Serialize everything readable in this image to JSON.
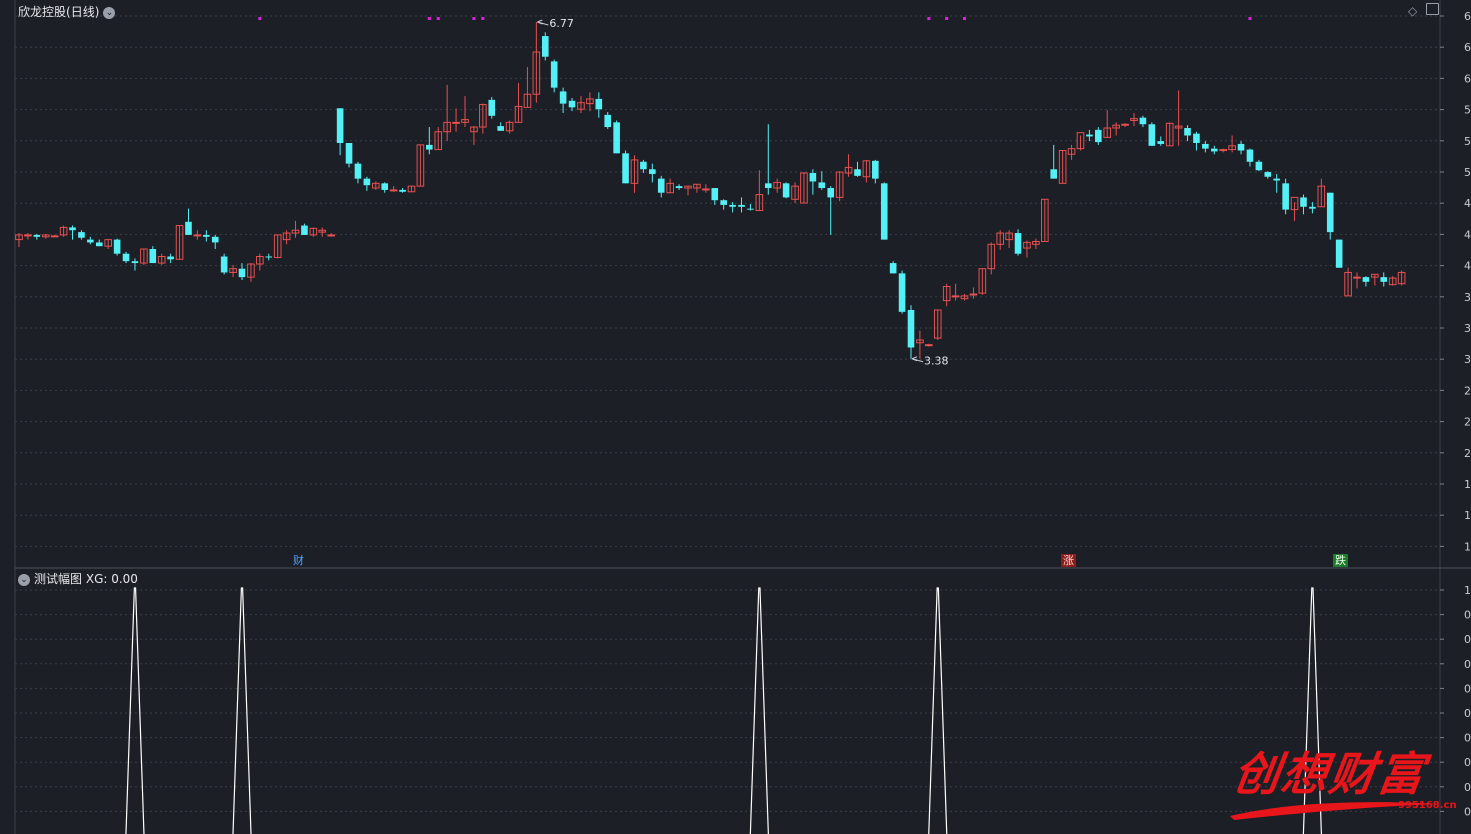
{
  "header": {
    "stock_name": "欣龙控股",
    "period_label": "(日线)",
    "indicator_name": "测试幅图",
    "indicator_value": "XG: 0.00"
  },
  "markers": {
    "cai": "财",
    "zhang": "涨",
    "die": "跌"
  },
  "watermark": {
    "text": "创想财富",
    "url": "995168.cn"
  },
  "colors": {
    "up": "#e6504f",
    "down": "#54f0f5",
    "dot": "#e020e0",
    "grid": "#3a3f4a",
    "background": "#1c1f26",
    "signal": "#ffffff",
    "watermark": "#e8151a"
  },
  "chart_data": [
    {
      "type": "candlestick",
      "title": "欣龙控股(日线)",
      "ylim": [
        3.3,
        6.9
      ],
      "high_label": "6.77",
      "low_label": "3.38",
      "candles": [
        [
          4.45,
          4.52,
          4.37,
          4.5
        ],
        [
          4.5,
          4.52,
          4.45,
          4.5
        ],
        [
          4.5,
          4.51,
          4.45,
          4.48
        ],
        [
          4.48,
          4.51,
          4.46,
          4.5
        ],
        [
          4.48,
          4.5,
          4.48,
          4.49
        ],
        [
          4.5,
          4.6,
          4.48,
          4.58
        ],
        [
          4.58,
          4.6,
          4.45,
          4.55
        ],
        [
          4.53,
          4.55,
          4.45,
          4.47
        ],
        [
          4.45,
          4.48,
          4.4,
          4.42
        ],
        [
          4.42,
          4.45,
          4.38,
          4.38
        ],
        [
          4.38,
          4.45,
          4.35,
          4.45
        ],
        [
          4.45,
          4.46,
          4.28,
          4.3
        ],
        [
          4.3,
          4.32,
          4.2,
          4.22
        ],
        [
          4.22,
          4.25,
          4.12,
          4.2
        ],
        [
          4.2,
          4.35,
          4.18,
          4.35
        ],
        [
          4.35,
          4.38,
          4.2,
          4.2
        ],
        [
          4.2,
          4.3,
          4.18,
          4.27
        ],
        [
          4.27,
          4.3,
          4.2,
          4.24
        ],
        [
          4.24,
          4.6,
          4.24,
          4.6
        ],
        [
          4.64,
          4.78,
          4.5,
          4.5
        ],
        [
          4.5,
          4.55,
          4.45,
          4.5
        ],
        [
          4.5,
          4.55,
          4.43,
          4.48
        ],
        [
          4.48,
          4.5,
          4.35,
          4.42
        ],
        [
          4.27,
          4.3,
          4.08,
          4.1
        ],
        [
          4.1,
          4.18,
          4.05,
          4.14
        ],
        [
          4.14,
          4.2,
          4.02,
          4.05
        ],
        [
          4.05,
          4.2,
          4.0,
          4.19
        ],
        [
          4.19,
          4.3,
          4.12,
          4.27
        ],
        [
          4.27,
          4.3,
          4.23,
          4.26
        ],
        [
          4.26,
          4.5,
          4.25,
          4.5
        ],
        [
          4.45,
          4.55,
          4.4,
          4.52
        ],
        [
          4.52,
          4.65,
          4.47,
          4.55
        ],
        [
          4.6,
          4.62,
          4.5,
          4.5
        ],
        [
          4.5,
          4.58,
          4.48,
          4.57
        ],
        [
          4.53,
          4.58,
          4.48,
          4.55
        ],
        [
          4.5,
          4.52,
          4.48,
          4.5
        ],
        [
          5.85,
          5.85,
          5.35,
          5.48
        ],
        [
          5.48,
          5.48,
          5.22,
          5.26
        ],
        [
          5.26,
          5.28,
          5.05,
          5.1
        ],
        [
          5.1,
          5.12,
          4.97,
          5.03
        ],
        [
          5.0,
          5.07,
          4.98,
          5.05
        ],
        [
          5.05,
          5.06,
          4.95,
          4.98
        ],
        [
          4.98,
          5.02,
          4.96,
          4.98
        ],
        [
          4.98,
          5.0,
          4.95,
          4.96
        ],
        [
          4.96,
          5.02,
          4.96,
          5.02
        ],
        [
          5.02,
          5.46,
          5.02,
          5.46
        ],
        [
          5.46,
          5.65,
          5.36,
          5.41
        ],
        [
          5.41,
          5.65,
          5.41,
          5.6
        ],
        [
          5.6,
          6.1,
          5.5,
          5.7
        ],
        [
          5.7,
          5.85,
          5.6,
          5.7
        ],
        [
          5.7,
          5.98,
          5.65,
          5.73
        ],
        [
          5.6,
          5.66,
          5.46,
          5.65
        ],
        [
          5.65,
          5.9,
          5.58,
          5.89
        ],
        [
          5.94,
          5.97,
          5.74,
          5.77
        ],
        [
          5.66,
          5.7,
          5.61,
          5.61
        ],
        [
          5.61,
          5.72,
          5.58,
          5.7
        ],
        [
          5.7,
          6.12,
          5.7,
          5.87
        ],
        [
          5.86,
          6.29,
          5.86,
          6.0
        ],
        [
          6.0,
          6.77,
          5.91,
          6.45
        ],
        [
          6.62,
          6.66,
          6.36,
          6.4
        ],
        [
          6.35,
          6.37,
          6.02,
          6.07
        ],
        [
          6.03,
          6.07,
          5.8,
          5.9
        ],
        [
          5.93,
          5.96,
          5.82,
          5.86
        ],
        [
          5.84,
          5.98,
          5.8,
          5.91
        ],
        [
          5.9,
          6.02,
          5.82,
          5.95
        ],
        [
          5.95,
          6.02,
          5.75,
          5.84
        ],
        [
          5.78,
          5.81,
          5.63,
          5.65
        ],
        [
          5.7,
          5.72,
          5.37,
          5.37
        ],
        [
          5.37,
          5.4,
          5.05,
          5.05
        ],
        [
          5.05,
          5.35,
          4.95,
          5.3
        ],
        [
          5.28,
          5.3,
          5.16,
          5.2
        ],
        [
          5.2,
          5.26,
          5.06,
          5.15
        ],
        [
          5.1,
          5.13,
          4.9,
          4.95
        ],
        [
          4.95,
          5.1,
          4.95,
          5.05
        ],
        [
          5.02,
          5.04,
          4.98,
          5.0
        ],
        [
          5.0,
          5.02,
          4.92,
          5.02
        ],
        [
          5.0,
          5.04,
          4.95,
          5.04
        ],
        [
          4.99,
          5.04,
          4.95,
          4.99
        ],
        [
          5.0,
          5.0,
          4.82,
          4.87
        ],
        [
          4.87,
          4.88,
          4.77,
          4.82
        ],
        [
          4.82,
          4.85,
          4.74,
          4.8
        ],
        [
          4.82,
          4.9,
          4.74,
          4.8
        ],
        [
          4.78,
          4.83,
          4.76,
          4.77
        ],
        [
          4.76,
          5.19,
          4.76,
          4.93
        ],
        [
          5.05,
          5.68,
          4.93,
          5.0
        ],
        [
          5.0,
          5.1,
          4.95,
          5.06
        ],
        [
          5.05,
          5.06,
          4.89,
          4.9
        ],
        [
          4.88,
          5.06,
          4.84,
          5.02
        ],
        [
          4.84,
          5.17,
          4.84,
          5.16
        ],
        [
          5.16,
          5.2,
          4.93,
          5.07
        ],
        [
          5.06,
          5.18,
          4.98,
          5.0
        ],
        [
          5.0,
          5.02,
          4.5,
          4.9
        ],
        [
          4.9,
          5.18,
          4.86,
          5.17
        ],
        [
          5.16,
          5.36,
          5.12,
          5.22
        ],
        [
          5.2,
          5.28,
          5.12,
          5.13
        ],
        [
          5.12,
          5.3,
          5.06,
          5.29
        ],
        [
          5.29,
          5.3,
          5.05,
          5.1
        ],
        [
          5.05,
          5.06,
          4.45,
          4.45
        ],
        [
          4.2,
          4.22,
          4.09,
          4.09
        ],
        [
          4.09,
          4.12,
          3.66,
          3.68
        ],
        [
          3.7,
          3.75,
          3.18,
          3.3
        ],
        [
          3.35,
          3.48,
          3.18,
          3.38
        ],
        [
          3.32,
          3.34,
          3.31,
          3.33
        ],
        [
          3.4,
          3.7,
          3.38,
          3.7
        ],
        [
          3.8,
          3.98,
          3.74,
          3.95
        ],
        [
          3.85,
          3.98,
          3.8,
          3.85
        ],
        [
          3.82,
          3.87,
          3.8,
          3.85
        ],
        [
          3.86,
          3.94,
          3.82,
          3.87
        ],
        [
          3.88,
          4.14,
          3.86,
          4.14
        ],
        [
          4.14,
          4.42,
          4.08,
          4.4
        ],
        [
          4.4,
          4.55,
          4.34,
          4.52
        ],
        [
          4.45,
          4.55,
          4.36,
          4.52
        ],
        [
          4.52,
          4.56,
          4.28,
          4.3
        ],
        [
          4.36,
          4.44,
          4.26,
          4.42
        ],
        [
          4.4,
          4.46,
          4.35,
          4.43
        ],
        [
          4.43,
          4.88,
          4.43,
          4.88
        ],
        [
          5.2,
          5.46,
          5.1,
          5.1
        ],
        [
          5.05,
          5.4,
          5.05,
          5.4
        ],
        [
          5.36,
          5.46,
          5.3,
          5.42
        ],
        [
          5.42,
          5.56,
          5.4,
          5.59
        ],
        [
          5.57,
          5.62,
          5.5,
          5.55
        ],
        [
          5.62,
          5.65,
          5.46,
          5.49
        ],
        [
          5.54,
          5.83,
          5.54,
          5.64
        ],
        [
          5.64,
          5.7,
          5.56,
          5.67
        ],
        [
          5.67,
          5.69,
          5.65,
          5.68
        ],
        [
          5.72,
          5.8,
          5.66,
          5.74
        ],
        [
          5.75,
          5.77,
          5.65,
          5.68
        ],
        [
          5.68,
          5.7,
          5.45,
          5.45
        ],
        [
          5.5,
          5.55,
          5.45,
          5.47
        ],
        [
          5.45,
          5.7,
          5.45,
          5.69
        ],
        [
          5.64,
          6.04,
          5.45,
          5.66
        ],
        [
          5.64,
          5.67,
          5.5,
          5.56
        ],
        [
          5.58,
          5.6,
          5.4,
          5.48
        ],
        [
          5.47,
          5.5,
          5.38,
          5.42
        ],
        [
          5.42,
          5.45,
          5.36,
          5.39
        ],
        [
          5.41,
          5.42,
          5.38,
          5.41
        ],
        [
          5.41,
          5.56,
          5.38,
          5.45
        ],
        [
          5.47,
          5.5,
          5.36,
          5.4
        ],
        [
          5.41,
          5.42,
          5.23,
          5.28
        ],
        [
          5.28,
          5.3,
          5.18,
          5.19
        ],
        [
          5.17,
          5.18,
          5.1,
          5.12
        ],
        [
          5.1,
          5.15,
          4.95,
          5.08
        ],
        [
          5.05,
          5.1,
          4.72,
          4.77
        ],
        [
          4.77,
          4.85,
          4.65,
          4.9
        ],
        [
          4.9,
          4.93,
          4.72,
          4.8
        ],
        [
          4.8,
          4.85,
          4.73,
          4.78
        ],
        [
          4.8,
          5.1,
          4.8,
          5.02
        ],
        [
          4.95,
          4.95,
          4.45,
          4.53
        ],
        [
          4.45,
          4.45,
          4.15,
          4.15
        ],
        [
          3.85,
          4.15,
          3.85,
          4.1
        ],
        [
          4.05,
          4.1,
          3.93,
          4.05
        ],
        [
          4.05,
          4.06,
          3.95,
          4.0
        ],
        [
          4.05,
          4.08,
          3.96,
          4.08
        ],
        [
          4.05,
          4.1,
          3.95,
          4.0
        ],
        [
          3.97,
          4.06,
          3.96,
          4.04
        ],
        [
          3.98,
          4.12,
          3.96,
          4.1
        ]
      ],
      "signal_dots_index": [
        27,
        46,
        47,
        51,
        52,
        102,
        104,
        106,
        138
      ]
    },
    {
      "type": "line",
      "title": "测试幅图",
      "series_value_label": "XG: 0.00",
      "ylim": [
        0,
        1
      ],
      "y_ticks": [
        1,
        0,
        0,
        0,
        0,
        0,
        0,
        0,
        0,
        0
      ],
      "spikes_index": [
        13,
        25,
        83,
        103,
        145
      ]
    }
  ]
}
